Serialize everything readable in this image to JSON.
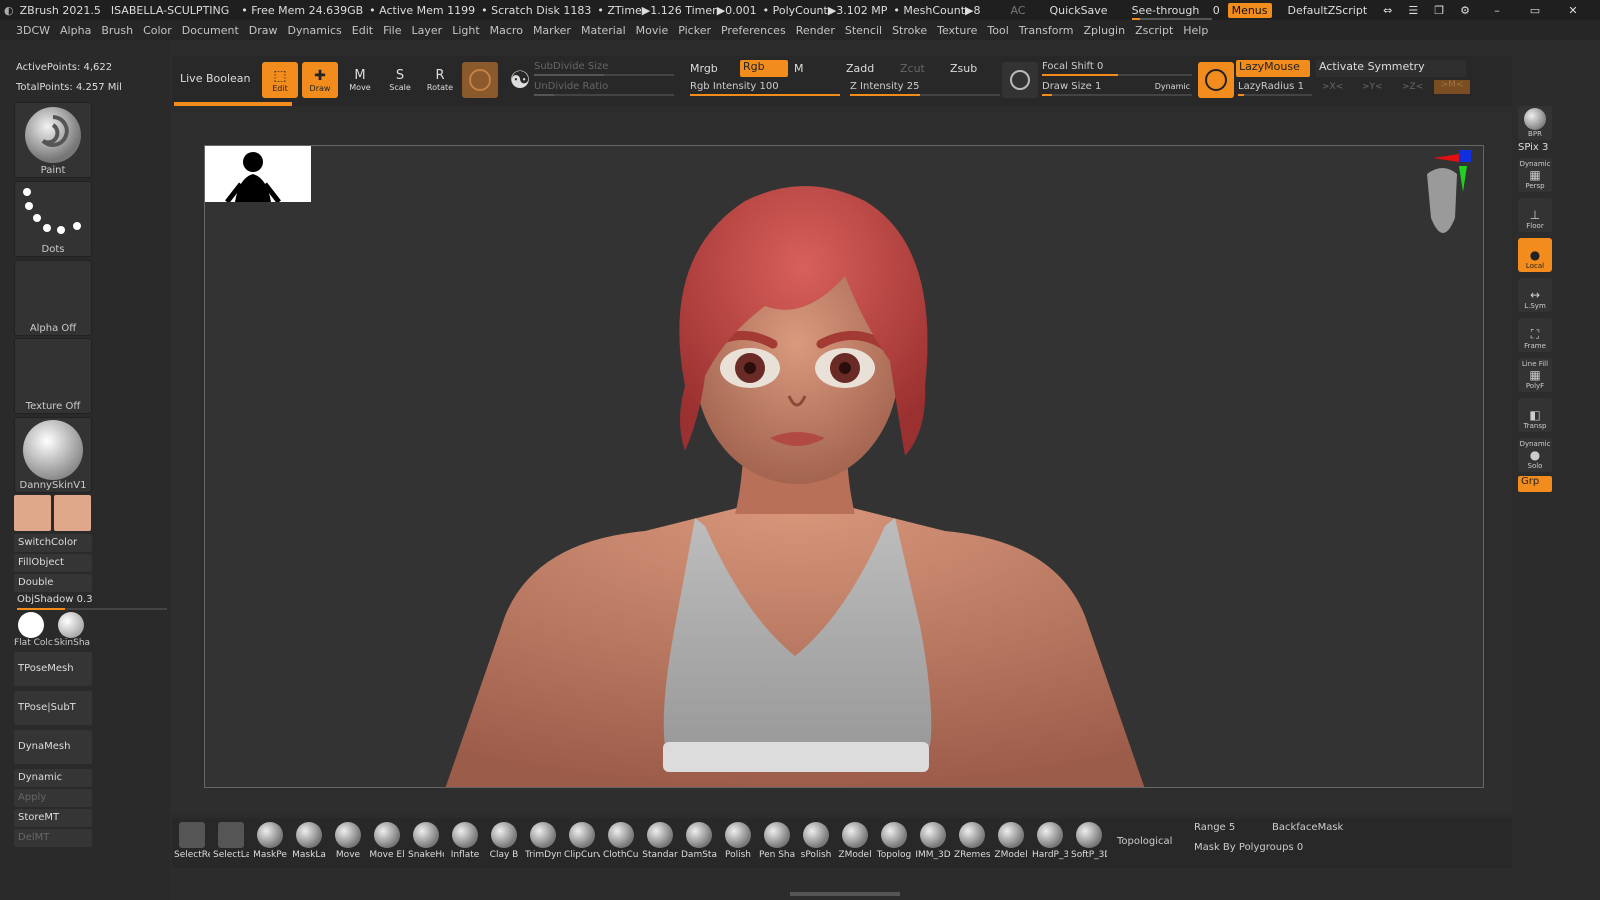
{
  "titlebar": {
    "app": "ZBrush 2021.5",
    "project": "ISABELLA-SCULPTING",
    "free_mem": "• Free Mem 24.639GB",
    "active_mem": "• Active Mem 1199",
    "scratch": "• Scratch Disk 1183",
    "ztime": "• ZTime▶1.126 Timer▶0.001",
    "polycount": "• PolyCount▶3.102 MP",
    "meshcount": "• MeshCount▶8",
    "ac": "AC",
    "quicksave": "QuickSave",
    "see_through": "See-through",
    "see_through_value": "0",
    "menus": "Menus",
    "script": "DefaultZScript"
  },
  "menubar": [
    "3DCW",
    "Alpha",
    "Brush",
    "Color",
    "Document",
    "Draw",
    "Dynamics",
    "Edit",
    "File",
    "Layer",
    "Light",
    "Macro",
    "Marker",
    "Material",
    "Movie",
    "Picker",
    "Preferences",
    "Render",
    "Stencil",
    "Stroke",
    "Texture",
    "Tool",
    "Transform",
    "Zplugin",
    "Zscript",
    "Help"
  ],
  "left": {
    "active_points": "ActivePoints: 4,622",
    "total_points": "TotalPoints: 4.257 Mil",
    "brush": "Paint",
    "stroke": "Dots",
    "alpha": "Alpha Off",
    "texture": "Texture Off",
    "material": "DannySkinV1",
    "switch_color": "SwitchColor",
    "fill_object": "FillObject",
    "double": "Double",
    "obj_shadow": "ObjShadow",
    "obj_shadow_value": "0.3",
    "flat_color": "Flat Colc",
    "skin_shade": "SkinSha",
    "tpose_mesh": "TPoseMesh",
    "tpose_subt": "TPose|SubT",
    "dynamesh": "DynaMesh",
    "dynamic": "Dynamic",
    "apply": "Apply",
    "store_mt": "StoreMT",
    "del_mt": "DelMT"
  },
  "toptools": {
    "live_boolean": "Live Boolean",
    "edit": "Edit",
    "draw": "Draw",
    "move": "Move",
    "scale": "Scale",
    "rotate": "Rotate",
    "subdivide_size": "SubDivide Size",
    "undivide_ratio": "UnDivide Ratio",
    "mrgb": "Mrgb",
    "rgb": "Rgb",
    "m": "M",
    "rgb_intensity": "Rgb Intensity 100",
    "zadd": "Zadd",
    "zcut": "Zcut",
    "zsub": "Zsub",
    "z_intensity": "Z Intensity 25",
    "focal_shift": "Focal Shift 0",
    "draw_size": "Draw Size 1",
    "dynamic": "Dynamic",
    "lazymouse": "LazyMouse",
    "lazyradius": "LazyRadius 1",
    "activate_symmetry": "Activate Symmetry",
    "sym_x": ">X<",
    "sym_y": ">Y<",
    "sym_z": ">Z<",
    "sym_m": ">M<"
  },
  "right": {
    "bpr": "BPR",
    "spix": "SPix 3",
    "persp": "Persp",
    "dynamic": "Dynamic",
    "floor": "Floor",
    "local": "Local",
    "lsym": "L.Sym",
    "frame": "Frame",
    "line_fill": "Line Fill",
    "polyf": "PolyF",
    "transp": "Transp",
    "solo_label": "Dynamic",
    "solo": "Solo",
    "grp": "Grp"
  },
  "bottom": {
    "brushes": [
      "SelectRe",
      "SelectLa",
      "MaskPe",
      "MaskLa",
      "Move",
      "Move El",
      "SnakeHo",
      "Inflate",
      "Clay B",
      "TrimDyn",
      "ClipCurv",
      "ClothCur",
      "Standar",
      "DamSta",
      "Polish",
      "Pen Sha",
      "sPolish",
      "ZModel",
      "Topolog",
      "IMM_3D",
      "ZRemes",
      "ZModel",
      "HardP_3",
      "SoftP_3D"
    ],
    "topological": "Topological",
    "range": "Range 5",
    "backface": "BackfaceMask",
    "mask_polygroups": "Mask By Polygroups 0"
  },
  "colors": {
    "accent": "#f28c1c",
    "hair": "#c8504a",
    "skin": "#c98a6e",
    "top": "#c7c7c7"
  }
}
